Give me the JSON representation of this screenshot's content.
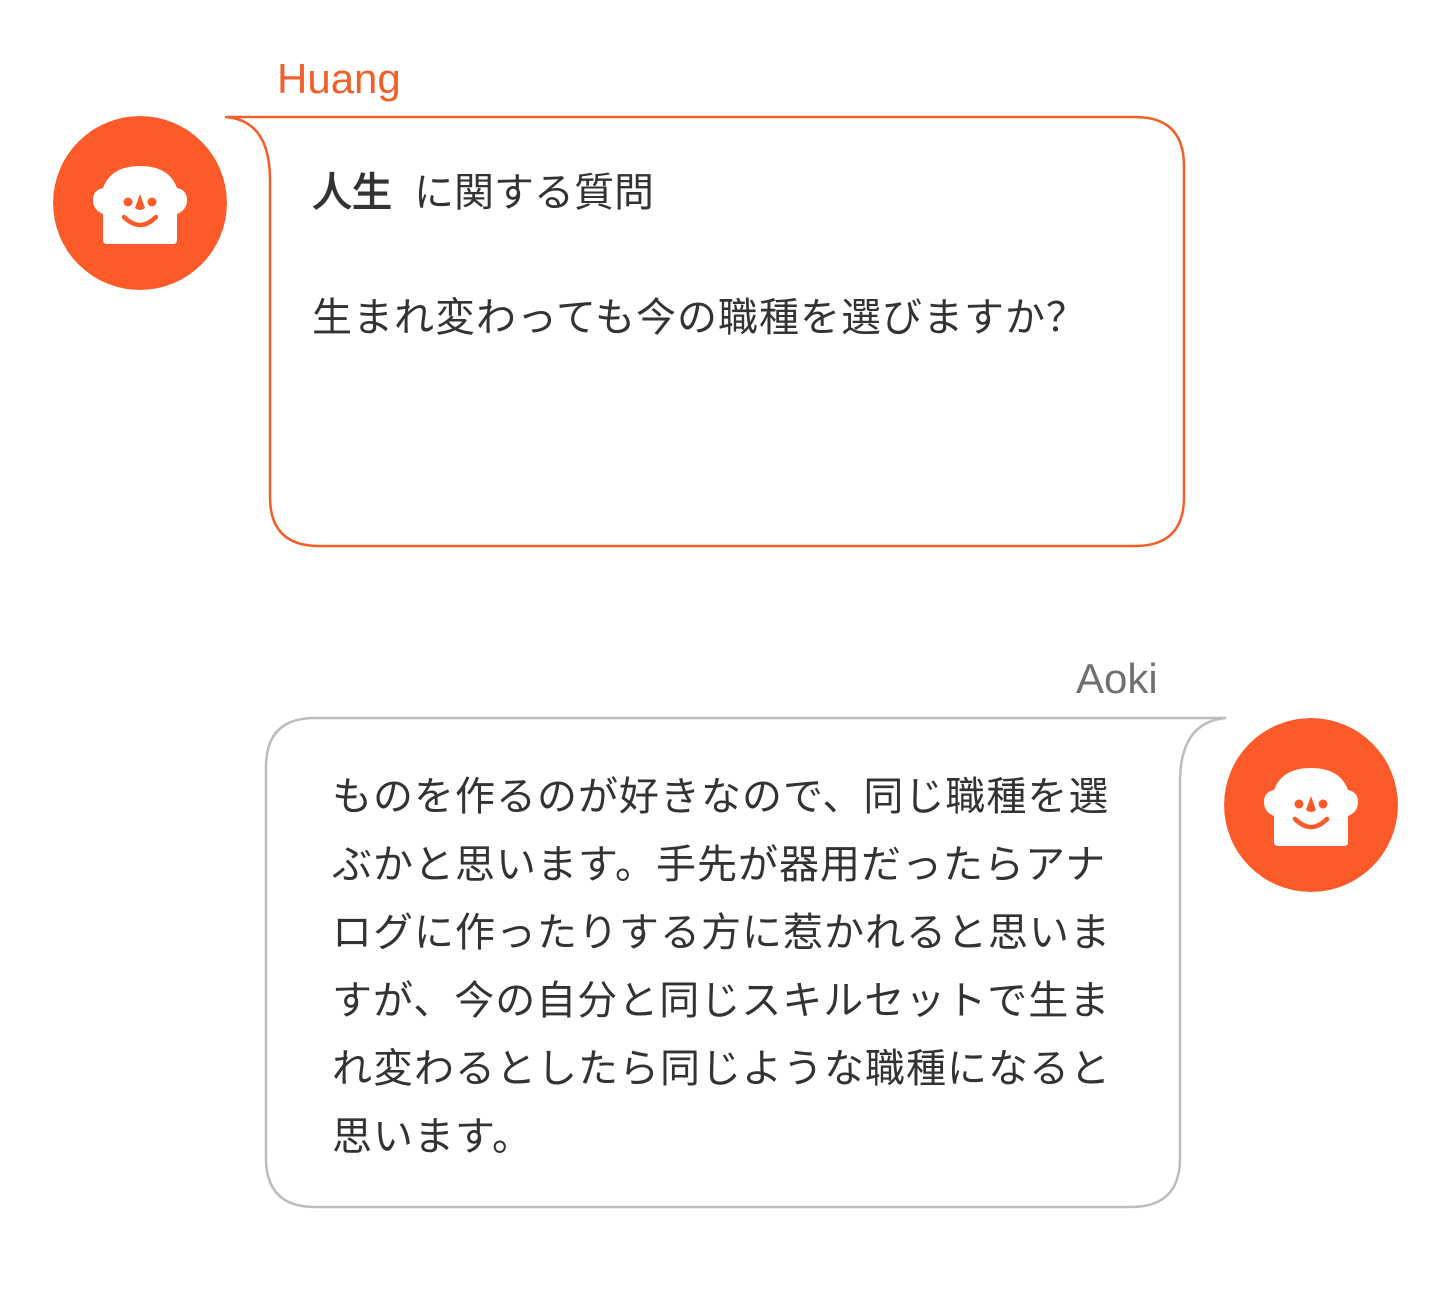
{
  "colors": {
    "accent": "#fd5a2a",
    "bubble_border_question": "#f2602a",
    "bubble_border_answer": "#bdbdbd",
    "name_answer": "#707070",
    "text": "#333333",
    "background": "#ffffff"
  },
  "question": {
    "sender": "Huang",
    "avatar_icon": "smiley-face-icon",
    "topic": "人生",
    "heading_suffix": "に関する質問",
    "body": "生まれ変わっても今の職種を選びますか？"
  },
  "answer": {
    "sender": "Aoki",
    "avatar_icon": "smiley-face-icon",
    "body": "ものを作るのが好きなので、同じ職種を選ぶかと思います。手先が器用だったらアナログに作ったりする方に惹かれると思いますが、今の自分と同じスキルセットで生まれ変わるとしたら同じような職種になると思います。"
  }
}
